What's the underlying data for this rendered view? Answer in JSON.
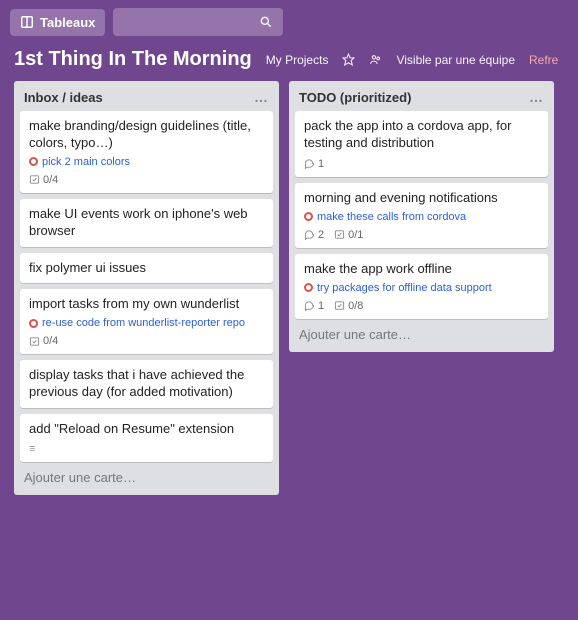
{
  "topbar": {
    "boards_label": "Tableaux"
  },
  "boardbar": {
    "title": "1st Thing In The Morning",
    "my_projects": "My Projects",
    "visibility": "Visible par une équipe",
    "refresh": "Refre"
  },
  "lists": [
    {
      "title": "Inbox / ideas",
      "add_card": "Ajouter une carte…",
      "cards": [
        {
          "title": "make branding/design guidelines (title, colors, typo…)",
          "warn": "pick 2 main colors",
          "checklist": "0/4"
        },
        {
          "title": "make UI events work on iphone's web browser"
        },
        {
          "title": "fix polymer ui issues"
        },
        {
          "title": "import tasks from my own wunderlist",
          "warn": "re-use code from wunderlist-reporter repo",
          "checklist": "0/4"
        },
        {
          "title": "display tasks that i have achieved the previous day (for added motivation)"
        },
        {
          "title": "add \"Reload on Resume\" extension",
          "bars": true
        }
      ]
    },
    {
      "title": "TODO (prioritized)",
      "add_card": "Ajouter une carte…",
      "cards": [
        {
          "title": "pack the app into a cordova app, for testing and distribution",
          "comments": "1"
        },
        {
          "title": "morning and evening notifications",
          "warn": "make these calls from cordova",
          "comments": "2",
          "checklist": "0/1"
        },
        {
          "title": "make the app work offline",
          "warn": "try packages for offline data support",
          "comments": "1",
          "checklist": "0/8"
        }
      ]
    }
  ]
}
